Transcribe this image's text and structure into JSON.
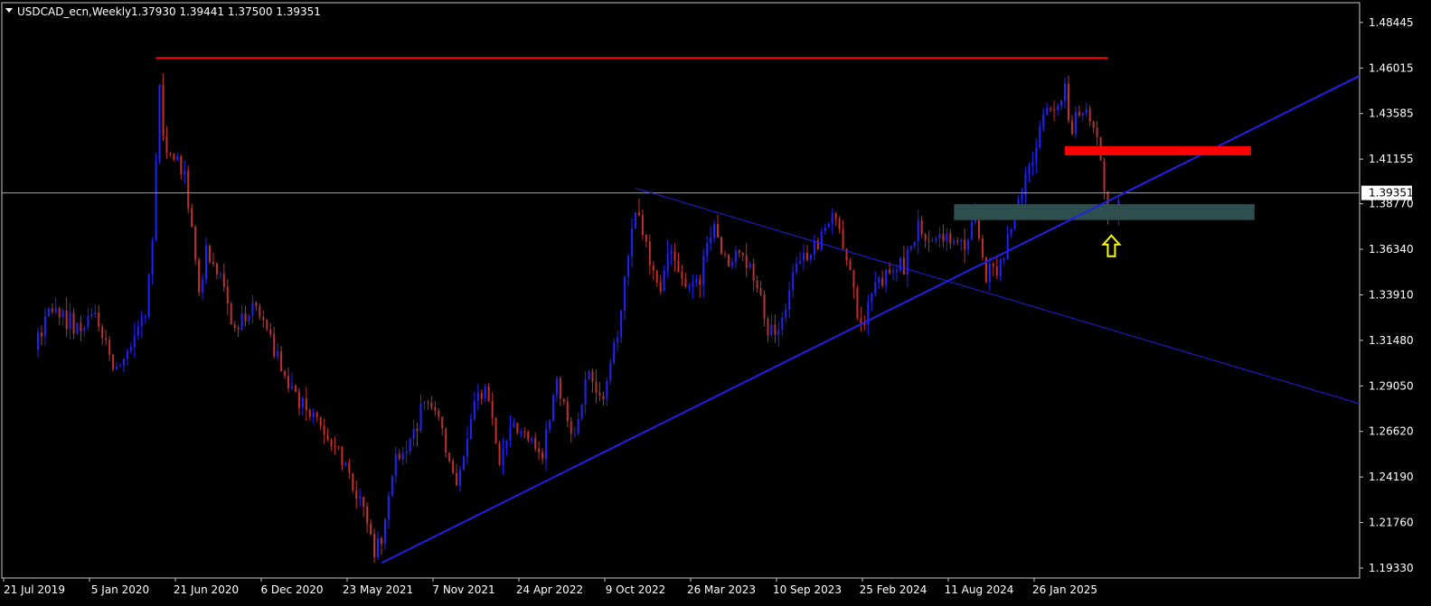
{
  "header": {
    "menu_icon": "triangle-down-icon",
    "title": "USDCAD_ecn,Weekly",
    "ohlc": "1.37930 1.39441 1.37500 1.39351"
  },
  "colors": {
    "background": "#000000",
    "frame": "#c8c8c8",
    "bull": "#2222ff",
    "bear": "#c03030",
    "resistance": "#ff0000",
    "trendline": "#2020e6",
    "support_zone": "#2f4f4f",
    "arrow": "#ffff00",
    "current_price_line": "#9aa3b5",
    "current_price_box": "#ffffff"
  },
  "chart_data": {
    "type": "candlestick",
    "symbol": "USDCAD_ecn",
    "timeframe": "Weekly",
    "current_price": "1.39351",
    "ylim": [
      1.188,
      1.495
    ],
    "y_ticks": [
      "1.48445",
      "1.46015",
      "1.43585",
      "1.41155",
      "1.38770",
      "1.36340",
      "1.33910",
      "1.31480",
      "1.29050",
      "1.26620",
      "1.24190",
      "1.21760",
      "1.19330"
    ],
    "x_ticks": [
      "21 Jul 2019",
      "5 Jan 2020",
      "21 Jun 2020",
      "6 Dec 2020",
      "23 May 2021",
      "7 Nov 2021",
      "24 Apr 2022",
      "9 Oct 2022",
      "26 Mar 2023",
      "10 Sep 2023",
      "25 Feb 2024",
      "11 Aug 2024",
      "26 Jan 2025"
    ],
    "x_tick_dates": [
      "2019-07-21",
      "2020-01-05",
      "2020-06-21",
      "2020-12-06",
      "2021-05-23",
      "2021-11-07",
      "2022-04-24",
      "2022-10-09",
      "2023-03-26",
      "2023-09-10",
      "2024-02-25",
      "2024-08-11",
      "2025-01-26"
    ],
    "price_path": [
      [
        "2019-07-21",
        1.31
      ],
      [
        "2019-08-25",
        1.332
      ],
      [
        "2019-10-13",
        1.32
      ],
      [
        "2019-11-17",
        1.33
      ],
      [
        "2019-12-22",
        1.3
      ],
      [
        "2020-01-12",
        1.305
      ],
      [
        "2020-02-23",
        1.33
      ],
      [
        "2020-03-08",
        1.37
      ],
      [
        "2020-03-22",
        1.45
      ],
      [
        "2020-03-29",
        1.42
      ],
      [
        "2020-04-26",
        1.41
      ],
      [
        "2020-05-10",
        1.4
      ],
      [
        "2020-06-07",
        1.34
      ],
      [
        "2020-06-21",
        1.36
      ],
      [
        "2020-07-19",
        1.35
      ],
      [
        "2020-08-16",
        1.32
      ],
      [
        "2020-09-13",
        1.33
      ],
      [
        "2020-09-27",
        1.335
      ],
      [
        "2020-10-25",
        1.315
      ],
      [
        "2020-11-22",
        1.295
      ],
      [
        "2020-12-20",
        1.28
      ],
      [
        "2021-01-17",
        1.275
      ],
      [
        "2021-02-21",
        1.26
      ],
      [
        "2021-03-28",
        1.245
      ],
      [
        "2021-05-16",
        1.205
      ],
      [
        "2021-05-30",
        1.204
      ],
      [
        "2021-06-20",
        1.245
      ],
      [
        "2021-07-18",
        1.26
      ],
      [
        "2021-08-22",
        1.28
      ],
      [
        "2021-09-19",
        1.275
      ],
      [
        "2021-10-24",
        1.235
      ],
      [
        "2021-11-21",
        1.275
      ],
      [
        "2021-12-19",
        1.29
      ],
      [
        "2022-01-16",
        1.25
      ],
      [
        "2022-02-13",
        1.27
      ],
      [
        "2022-03-13",
        1.265
      ],
      [
        "2022-04-10",
        1.25
      ],
      [
        "2022-05-08",
        1.295
      ],
      [
        "2022-06-05",
        1.26
      ],
      [
        "2022-07-10",
        1.3
      ],
      [
        "2022-08-07",
        1.285
      ],
      [
        "2022-09-04",
        1.32
      ],
      [
        "2022-10-09",
        1.385
      ],
      [
        "2022-11-06",
        1.36
      ],
      [
        "2022-11-27",
        1.34
      ],
      [
        "2022-12-18",
        1.365
      ],
      [
        "2023-01-15",
        1.34
      ],
      [
        "2023-02-12",
        1.35
      ],
      [
        "2023-03-12",
        1.375
      ],
      [
        "2023-04-09",
        1.355
      ],
      [
        "2023-04-30",
        1.36
      ],
      [
        "2023-05-28",
        1.35
      ],
      [
        "2023-06-25",
        1.32
      ],
      [
        "2023-07-16",
        1.315
      ],
      [
        "2023-08-13",
        1.355
      ],
      [
        "2023-09-03",
        1.36
      ],
      [
        "2023-10-01",
        1.365
      ],
      [
        "2023-10-29",
        1.385
      ],
      [
        "2023-11-26",
        1.36
      ],
      [
        "2023-12-24",
        1.32
      ],
      [
        "2024-01-21",
        1.345
      ],
      [
        "2024-02-18",
        1.35
      ],
      [
        "2024-03-17",
        1.355
      ],
      [
        "2024-04-14",
        1.375
      ],
      [
        "2024-05-12",
        1.365
      ],
      [
        "2024-06-09",
        1.37
      ],
      [
        "2024-07-07",
        1.365
      ],
      [
        "2024-08-04",
        1.38
      ],
      [
        "2024-08-25",
        1.35
      ],
      [
        "2024-09-22",
        1.355
      ],
      [
        "2024-10-20",
        1.385
      ],
      [
        "2024-11-17",
        1.405
      ],
      [
        "2024-12-15",
        1.435
      ],
      [
        "2025-01-05",
        1.44
      ],
      [
        "2025-01-26",
        1.448
      ],
      [
        "2025-02-09",
        1.428
      ],
      [
        "2025-02-23",
        1.44
      ],
      [
        "2025-03-09",
        1.435
      ],
      [
        "2025-03-23",
        1.43
      ],
      [
        "2025-04-06",
        1.41
      ],
      [
        "2025-04-20",
        1.385
      ],
      [
        "2025-05-04",
        1.38
      ],
      [
        "2025-05-11",
        1.3935
      ]
    ],
    "drawings": {
      "resistance_line": {
        "from": "2020-03-15",
        "to": "2025-04-20",
        "price": 1.4655
      },
      "ascending_trendline": {
        "from": "2021-05-30",
        "from_price": 1.196,
        "to_edge_price": 1.456
      },
      "descending_trendline": {
        "from": "2022-10-09",
        "from_price": 1.396,
        "to_edge_price": 1.281
      },
      "red_resistance_zone": {
        "from": "2025-01-26",
        "to": "2026-01-25",
        "low": 1.415,
        "high": 1.417
      },
      "support_zone": {
        "from": "2024-06-23",
        "to": "2026-02-01",
        "low": 1.379,
        "high": 1.3875
      },
      "up_arrow": {
        "date": "2025-04-27",
        "price": 1.365
      }
    }
  }
}
